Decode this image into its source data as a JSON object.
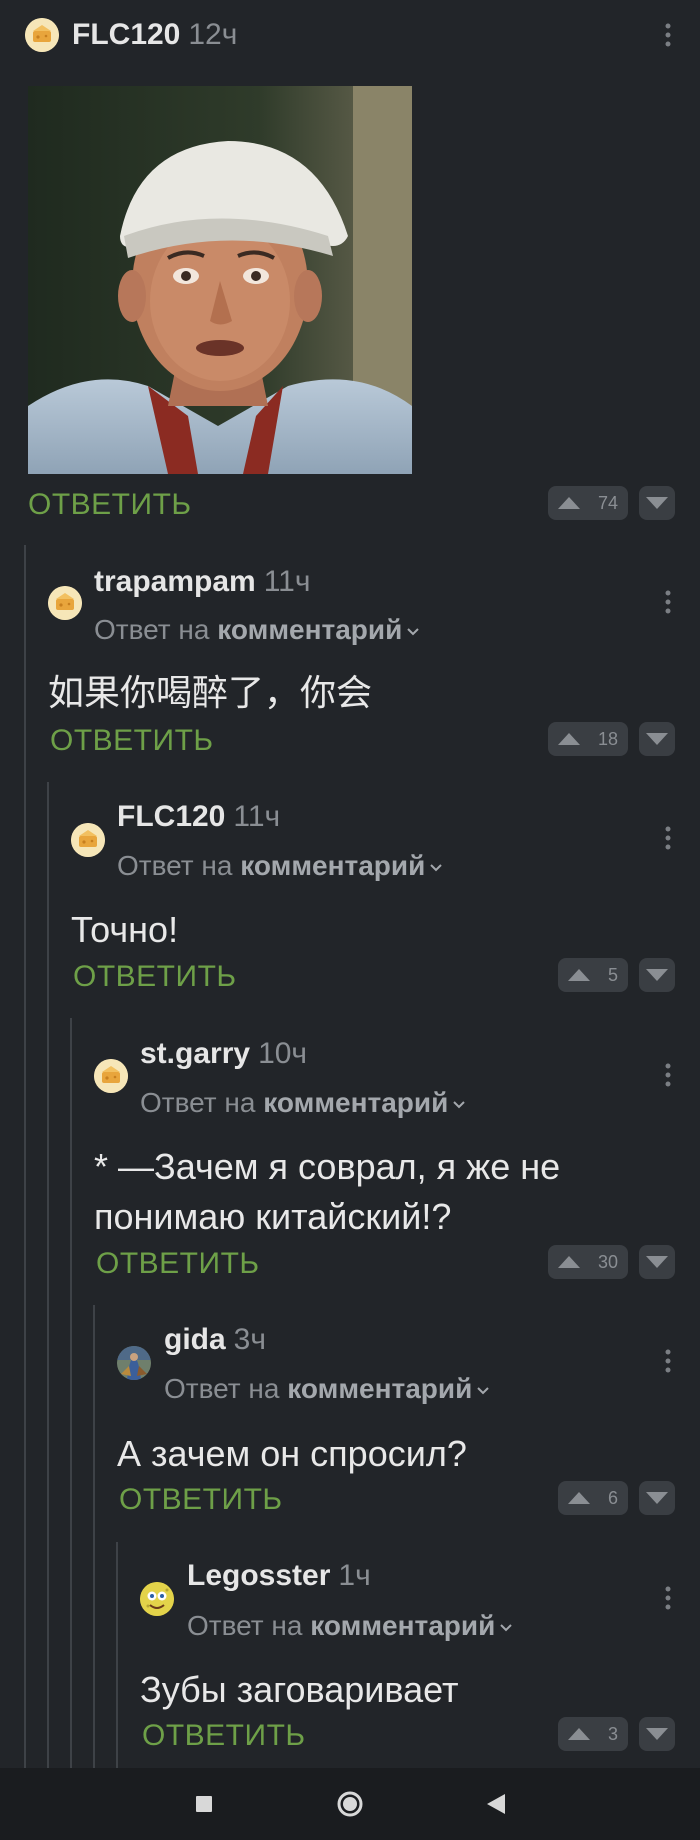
{
  "comments": [
    {
      "author": "FLC120",
      "time": "12ч",
      "reply_label": "ОТВЕТИТЬ",
      "votes": "74",
      "avatar": "cheese-avatar"
    },
    {
      "author": "trapampam",
      "time": "11ч",
      "reply_prefix": "Ответ на",
      "reply_target": "комментарий",
      "text": "如果你喝醉了，你会",
      "reply_label": "ОТВЕТИТЬ",
      "votes": "18",
      "avatar": "cheese-avatar"
    },
    {
      "author": "FLC120",
      "time": "11ч",
      "reply_prefix": "Ответ на",
      "reply_target": "комментарий",
      "text": "Точно!",
      "reply_label": "ОТВЕТИТЬ",
      "votes": "5",
      "avatar": "cheese-avatar"
    },
    {
      "author": "st.garry",
      "time": "10ч",
      "reply_prefix": "Ответ на",
      "reply_target": "комментарий",
      "text": "* —Зачем я соврал, я же не понимаю китайский!?",
      "reply_label": "ОТВЕТИТЬ",
      "votes": "30",
      "avatar": "cheese-avatar"
    },
    {
      "author": "gida",
      "time": "3ч",
      "reply_prefix": "Ответ на",
      "reply_target": "комментарий",
      "text": "А зачем он спросил?",
      "reply_label": "ОТВЕТИТЬ",
      "votes": "6",
      "avatar": "painting-avatar"
    },
    {
      "author": "Legosster",
      "time": "1ч",
      "reply_prefix": "Ответ на",
      "reply_target": "комментарий",
      "text": "Зубы заговаривает",
      "reply_label": "ОТВЕТИТЬ",
      "votes": "3",
      "avatar": "sponge-avatar"
    }
  ],
  "icons": {
    "menu": "more-vertical-icon",
    "upvote": "upvote-icon",
    "downvote": "downvote-icon",
    "nav_recent": "square-icon",
    "nav_home": "circle-icon",
    "nav_back": "triangle-back-icon"
  },
  "colors": {
    "background": "#222529",
    "reply_green": "#6ea048",
    "muted": "#8a8e93"
  }
}
